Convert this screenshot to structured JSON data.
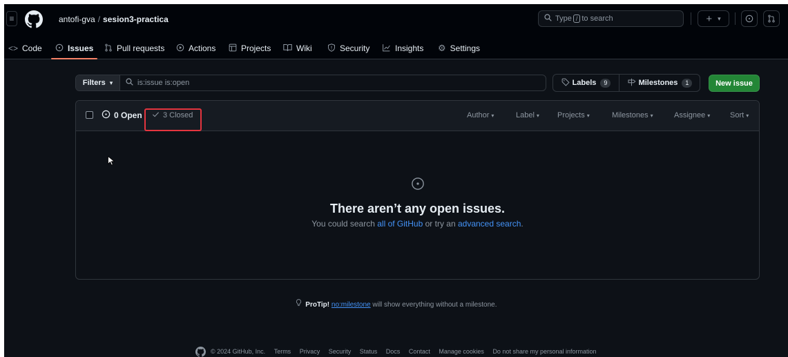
{
  "header": {
    "owner": "antofi-gva",
    "separator": "/",
    "repo": "sesion3-practica",
    "search": {
      "prefix": "Type",
      "key": "/",
      "suffix": "to search"
    },
    "plus_label": "+",
    "caret": "▾"
  },
  "nav": {
    "items": [
      {
        "label": "Code",
        "icon": "code-icon"
      },
      {
        "label": "Issues",
        "icon": "issue-opened-icon",
        "active": true
      },
      {
        "label": "Pull requests",
        "icon": "git-pull-request-icon"
      },
      {
        "label": "Actions",
        "icon": "play-icon"
      },
      {
        "label": "Projects",
        "icon": "table-icon"
      },
      {
        "label": "Wiki",
        "icon": "book-icon"
      },
      {
        "label": "Security",
        "icon": "shield-icon"
      },
      {
        "label": "Insights",
        "icon": "graph-icon"
      },
      {
        "label": "Settings",
        "icon": "gear-icon"
      }
    ]
  },
  "filters": {
    "button_label": "Filters",
    "query": "is:issue is:open",
    "labels_label": "Labels",
    "labels_count": "9",
    "milestones_label": "Milestones",
    "milestones_count": "1",
    "new_issue_label": "New issue"
  },
  "issues": {
    "open_label": "0 Open",
    "closed_label": "3 Closed",
    "sort_menus": [
      "Author",
      "Label",
      "Projects",
      "Milestones",
      "Assignee",
      "Sort"
    ],
    "blank_title": "There aren’t any open issues.",
    "blank_desc_1": "You could search ",
    "blank_link_1": "all of GitHub",
    "blank_desc_2": " or try an ",
    "blank_link_2": "advanced search",
    "blank_desc_3": "."
  },
  "protip": {
    "label": "ProTip!",
    "link": "no:milestone",
    "text": " will show everything without a milestone."
  },
  "footer": {
    "copyright": "© 2024 GitHub, Inc.",
    "links": [
      "Terms",
      "Privacy",
      "Security",
      "Status",
      "Docs",
      "Contact",
      "Manage cookies",
      "Do not share my personal information"
    ]
  },
  "colors": {
    "background": "#0d1117",
    "header": "#010409",
    "accent_tab": "#f78166",
    "primary_button": "#238636",
    "link": "#4493f8",
    "highlight": "#e5353f"
  }
}
